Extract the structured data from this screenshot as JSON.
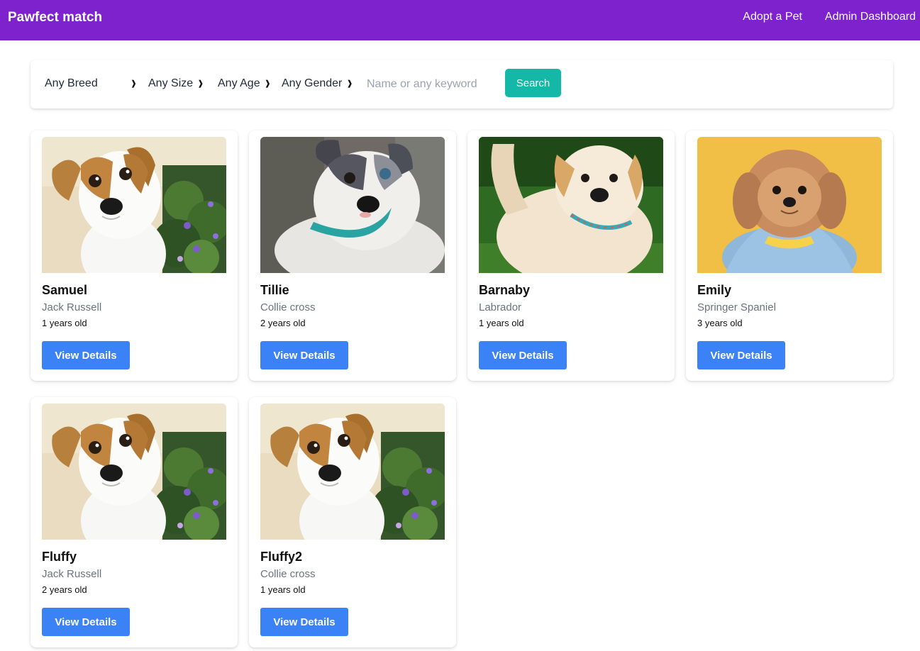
{
  "header": {
    "brand": "Pawfect match",
    "nav": [
      "Adopt a Pet",
      "Admin Dashboard"
    ]
  },
  "filters": {
    "breed": "Any Breed",
    "size": "Any Size",
    "age": "Any Age",
    "gender": "Any Gender",
    "keyword_placeholder": "Name or any keyword",
    "search_label": "Search"
  },
  "pets": [
    {
      "name": "Samuel",
      "breed": "Jack Russell",
      "age": "1 years old",
      "button": "View Details",
      "photo": "jack-russell-puppy"
    },
    {
      "name": "Tillie",
      "breed": "Collie cross",
      "age": "2 years old",
      "button": "View Details",
      "photo": "merle-puppy"
    },
    {
      "name": "Barnaby",
      "breed": "Labrador",
      "age": "1 years old",
      "button": "View Details",
      "photo": "golden-puppy"
    },
    {
      "name": "Emily",
      "breed": "Springer Spaniel",
      "age": "3 years old",
      "button": "View Details",
      "photo": "shih-tzu-on-yellow"
    },
    {
      "name": "Fluffy",
      "breed": "Jack Russell",
      "age": "2 years old",
      "button": "View Details",
      "photo": "jack-russell-puppy"
    },
    {
      "name": "Fluffy2",
      "breed": "Collie cross",
      "age": "1 years old",
      "button": "View Details",
      "photo": "jack-russell-puppy"
    }
  ],
  "colors": {
    "header": "#7e22ce",
    "search_button": "#14b8a6",
    "details_button": "#3b82f6"
  }
}
